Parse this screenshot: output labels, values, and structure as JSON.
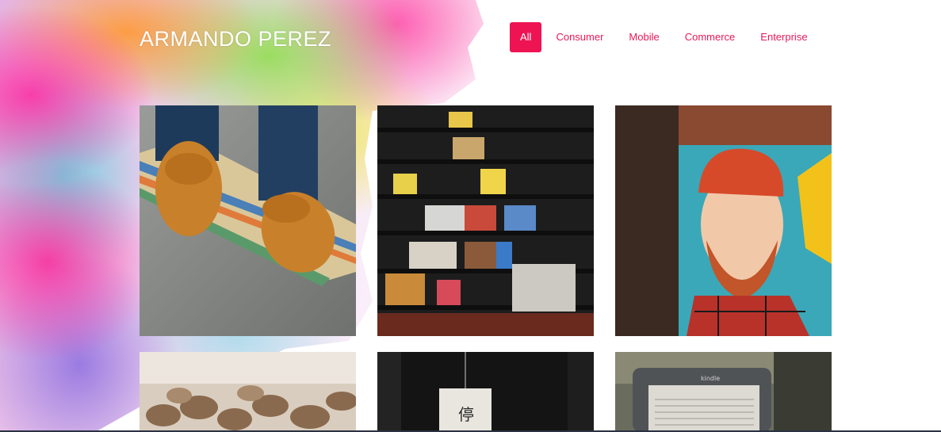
{
  "header": {
    "brand": "ARMANDO PEREZ"
  },
  "filters": {
    "items": [
      "All",
      "Consumer",
      "Mobile",
      "Commerce",
      "Enterprise"
    ],
    "active": "All"
  },
  "colors": {
    "accent": "#ee1454",
    "link": "#e8195a"
  },
  "gallery": {
    "tiles": [
      {
        "image": "skateboard-shoes-image"
      },
      {
        "image": "bookshelf-image"
      },
      {
        "image": "mural-portrait-image"
      },
      {
        "image": "coffee-beans-image"
      },
      {
        "image": "paper-lantern-image"
      },
      {
        "image": "kindle-ereader-image"
      }
    ],
    "kindle_text": "kindle"
  }
}
